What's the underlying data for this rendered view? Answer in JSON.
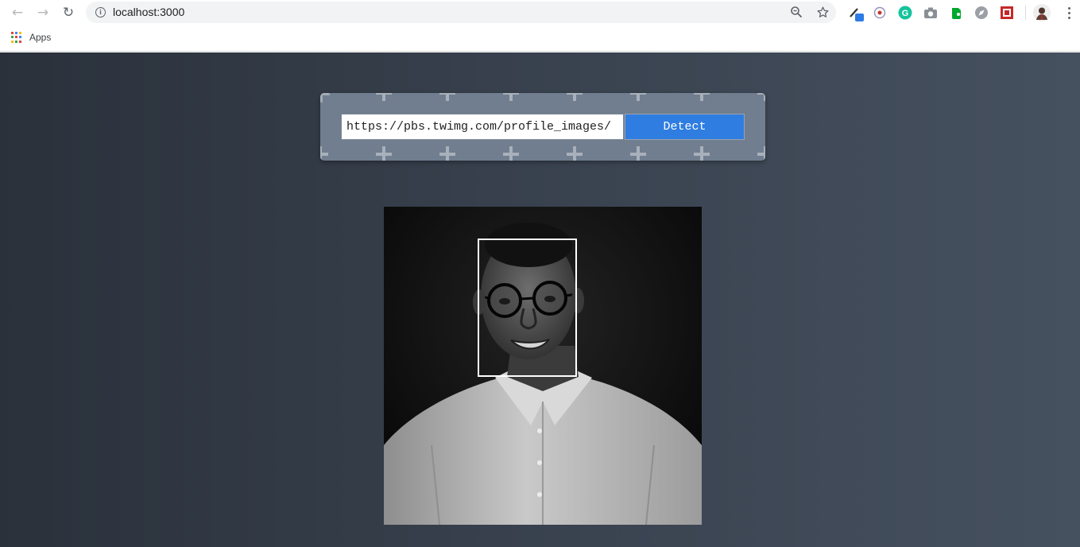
{
  "browser": {
    "url": "localhost:3000",
    "bookmarks": {
      "apps_label": "Apps"
    }
  },
  "form": {
    "url_input_value": "https://pbs.twimg.com/profile_images/",
    "detect_label": "Detect"
  },
  "colors": {
    "page_bg_left": "#2a313b",
    "page_bg_right": "#465160",
    "panel": "#707e8f",
    "button": "#2f7de1",
    "face_box": "#ffffff"
  },
  "icons": [
    "back-icon",
    "forward-icon",
    "reload-icon",
    "info-icon",
    "zoom-icon",
    "star-icon",
    "eyedropper-icon",
    "extension-icon",
    "grammarly-icon",
    "camera-icon",
    "evernote-icon",
    "compass-icon",
    "pdf-icon",
    "profile-avatar",
    "menu-icon",
    "apps-grid-icon"
  ]
}
